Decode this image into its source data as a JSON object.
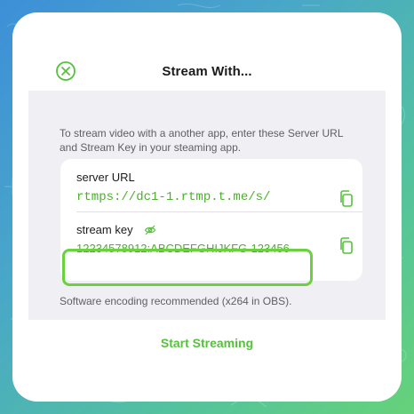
{
  "dialog": {
    "title": "Stream With...",
    "description": "To stream video with a another app, enter these Server URL and Stream Key in your steaming app.",
    "server_label": "server URL",
    "server_url": "rtmps://dc1-1.rtmp.t.me/s/",
    "stream_key_label": "stream key",
    "stream_key": "12234578912:ABCDEFGHIJKFG-123456",
    "note": "Software encoding recommended (x264 in OBS).",
    "start_button": "Start Streaming"
  },
  "colors": {
    "accent": "#57c13e",
    "highlight_box": "#6bd13f",
    "panel_bg": "#efeff4",
    "card_bg": "#ffffff"
  },
  "icons": {
    "close": "close-circle-icon",
    "copy": "copy-icon",
    "eye": "eye-hidden-icon"
  }
}
